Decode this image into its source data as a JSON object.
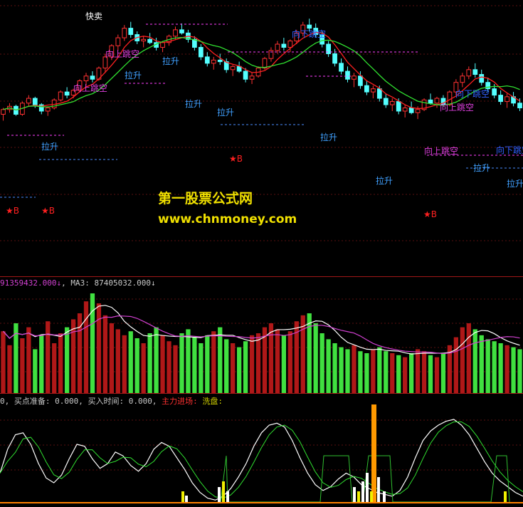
{
  "watermark": {
    "title": "第一股票公式网",
    "url": "www.chnmoney.com"
  },
  "volume_panel": {
    "header_ma2": "91359432.000",
    "header_ma2_arrow": "↓",
    "header_ma3_label": "MA3:",
    "header_ma3": "87405032.000",
    "header_ma3_arrow": "↓",
    "header_sep": ",",
    "color_label": "#c8c8c8",
    "color_ma2": "#d040d0"
  },
  "indicator_panel": {
    "prefix": "0,",
    "labels": [
      {
        "text": "买点准备:",
        "value": "0.000,",
        "color": "#c8c8c8"
      },
      {
        "text": "买入时间:",
        "value": "0.000,",
        "color": "#c8c8c8"
      },
      {
        "text": "主力进场:",
        "value": "",
        "color": "#ff3030"
      },
      {
        "text": "洗盘:",
        "value": "",
        "color": "#d0d000"
      }
    ]
  },
  "annotations": [
    {
      "text": "快卖",
      "color": "#ffffff"
    },
    {
      "text": "向下跳空",
      "color": "#3060ff"
    },
    {
      "text": "向上跳空",
      "color": "#e040e0"
    },
    {
      "text": "拉升",
      "color": "#40a0ff"
    },
    {
      "text": "★B",
      "color": "#ff2020"
    }
  ],
  "chart_data": [
    {
      "type": "candlestick",
      "title": "",
      "series": [
        {
          "name": "",
          "values": [
            [
              40,
              44,
              36,
              43
            ],
            [
              43,
              47,
              41,
              45
            ],
            [
              45,
              46,
              39,
              40
            ],
            [
              40,
              48,
              39,
              47
            ],
            [
              47,
              52,
              45,
              50
            ],
            [
              50,
              51,
              44,
              46
            ],
            [
              46,
              47,
              40,
              42
            ],
            [
              42,
              45,
              39,
              44
            ],
            [
              44,
              50,
              43,
              49
            ],
            [
              49,
              55,
              48,
              54
            ],
            [
              54,
              57,
              50,
              52
            ],
            [
              52,
              56,
              50,
              55
            ],
            [
              55,
              62,
              54,
              61
            ],
            [
              61,
              66,
              58,
              64
            ],
            [
              64,
              67,
              60,
              62
            ],
            [
              62,
              70,
              61,
              69
            ],
            [
              69,
              78,
              66,
              76
            ],
            [
              76,
              84,
              74,
              83
            ],
            [
              83,
              90,
              80,
              88
            ],
            [
              88,
              96,
              86,
              94
            ],
            [
              94,
              98,
              88,
              90
            ],
            [
              90,
              92,
              84,
              86
            ],
            [
              86,
              89,
              82,
              87
            ],
            [
              87,
              91,
              84,
              85
            ],
            [
              85,
              88,
              80,
              82
            ],
            [
              82,
              86,
              79,
              85
            ],
            [
              85,
              90,
              83,
              89
            ],
            [
              89,
              95,
              87,
              93
            ],
            [
              93,
              97,
              90,
              91
            ],
            [
              91,
              93,
              85,
              87
            ],
            [
              87,
              89,
              80,
              82
            ],
            [
              82,
              84,
              74,
              76
            ],
            [
              76,
              79,
              70,
              72
            ],
            [
              72,
              76,
              68,
              74
            ],
            [
              74,
              78,
              71,
              73
            ],
            [
              73,
              75,
              66,
              68
            ],
            [
              68,
              71,
              64,
              70
            ],
            [
              70,
              73,
              66,
              67
            ],
            [
              67,
              69,
              60,
              62
            ],
            [
              62,
              66,
              59,
              64
            ],
            [
              64,
              70,
              63,
              69
            ],
            [
              69,
              76,
              68,
              75
            ],
            [
              75,
              82,
              73,
              80
            ],
            [
              80,
              86,
              78,
              84
            ],
            [
              84,
              88,
              80,
              82
            ],
            [
              82,
              87,
              79,
              86
            ],
            [
              86,
              93,
              84,
              91
            ],
            [
              91,
              98,
              89,
              96
            ],
            [
              96,
              100,
              92,
              94
            ],
            [
              94,
              97,
              88,
              90
            ],
            [
              90,
              92,
              82,
              84
            ],
            [
              84,
              86,
              76,
              78
            ],
            [
              78,
              81,
              70,
              72
            ],
            [
              72,
              75,
              65,
              67
            ],
            [
              67,
              70,
              60,
              62
            ],
            [
              62,
              66,
              57,
              64
            ],
            [
              64,
              67,
              56,
              58
            ],
            [
              58,
              61,
              52,
              54
            ],
            [
              54,
              58,
              50,
              56
            ],
            [
              56,
              58,
              48,
              50
            ],
            [
              50,
              53,
              44,
              46
            ],
            [
              46,
              50,
              42,
              48
            ],
            [
              48,
              50,
              40,
              42
            ],
            [
              42,
              46,
              38,
              44
            ],
            [
              44,
              48,
              40,
              41
            ],
            [
              41,
              45,
              37,
              43
            ],
            [
              43,
              50,
              42,
              49
            ],
            [
              49,
              53,
              46,
              47
            ],
            [
              47,
              51,
              44,
              50
            ],
            [
              50,
              52,
              45,
              46
            ],
            [
              46,
              55,
              45,
              54
            ],
            [
              54,
              62,
              52,
              60
            ],
            [
              60,
              66,
              57,
              64
            ],
            [
              64,
              70,
              62,
              68
            ],
            [
              68,
              72,
              63,
              65
            ],
            [
              65,
              68,
              58,
              60
            ],
            [
              60,
              63,
              54,
              56
            ],
            [
              56,
              59,
              50,
              52
            ],
            [
              52,
              55,
              46,
              48
            ],
            [
              48,
              53,
              44,
              51
            ],
            [
              51,
              54,
              45,
              47
            ],
            [
              47,
              50,
              42,
              44
            ]
          ]
        }
      ],
      "ma_lines": [
        "MA5",
        "MA10"
      ]
    },
    {
      "type": "bar",
      "title": "",
      "series": [
        {
          "name": "",
          "values": [
            62,
            48,
            70,
            55,
            66,
            44,
            58,
            72,
            50,
            60,
            66,
            74,
            80,
            92,
            100,
            90,
            78,
            70,
            64,
            58,
            62,
            55,
            50,
            60,
            66,
            58,
            52,
            48,
            60,
            64,
            56,
            50,
            58,
            62,
            66,
            54,
            50,
            46,
            52,
            58,
            60,
            66,
            70,
            64,
            58,
            62,
            72,
            78,
            80,
            70,
            60,
            54,
            50,
            46,
            44,
            48,
            42,
            40,
            44,
            46,
            42,
            40,
            38,
            36,
            40,
            44,
            42,
            38,
            36,
            40,
            48,
            56,
            66,
            70,
            64,
            58,
            54,
            52,
            50,
            48,
            46,
            44
          ]
        },
        {
          "name": "MA3",
          "values": []
        }
      ]
    },
    {
      "type": "line",
      "title": "",
      "x": [],
      "series": [
        {
          "name": "",
          "values": [
            30,
            55,
            70,
            72,
            60,
            40,
            25,
            20,
            28,
            45,
            60,
            58,
            45,
            35,
            40,
            52,
            48,
            38,
            32,
            40,
            55,
            62,
            58,
            46,
            34,
            20,
            10,
            4,
            2,
            6,
            14,
            26,
            40,
            58,
            72,
            80,
            82,
            78,
            64,
            46,
            30,
            18,
            12,
            16,
            24,
            30,
            26,
            18,
            14,
            10,
            8,
            6,
            12,
            26,
            46,
            64,
            74,
            80,
            84,
            86,
            80,
            70,
            56,
            42,
            30,
            22,
            16,
            10,
            6
          ]
        }
      ]
    }
  ]
}
